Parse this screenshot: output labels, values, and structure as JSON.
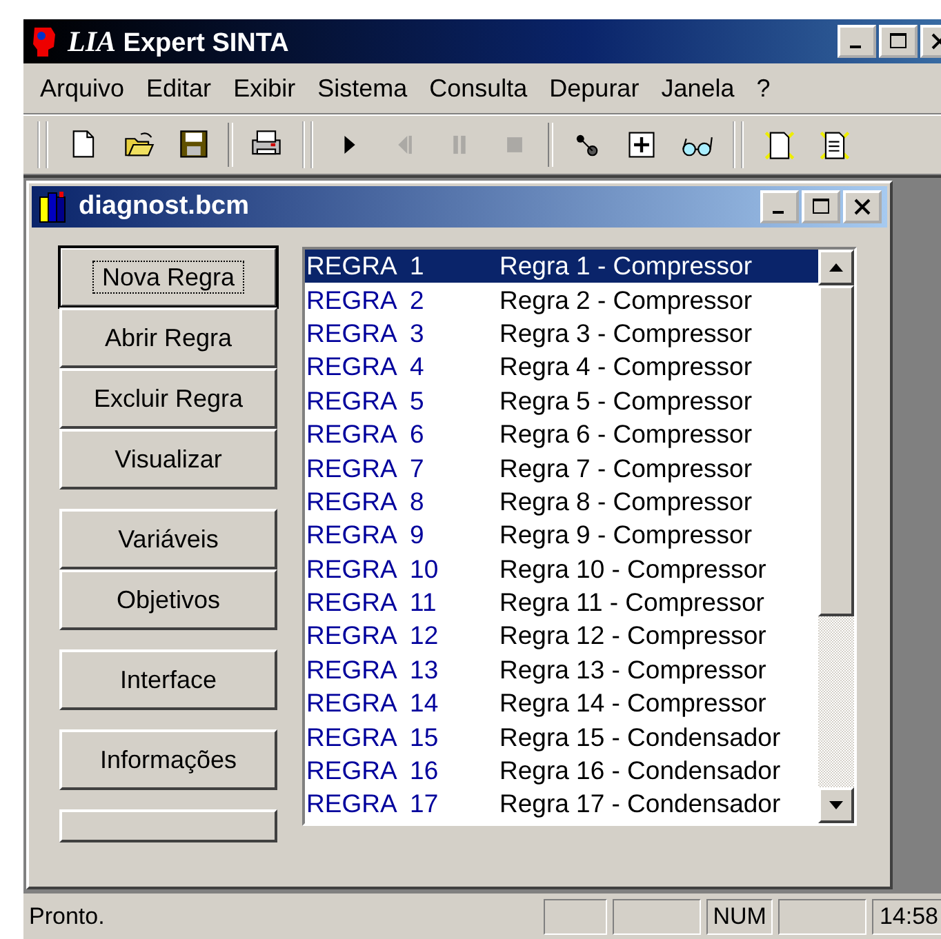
{
  "window": {
    "title_logo": "LIA",
    "title": "Expert SINTA"
  },
  "menu": [
    "Arquivo",
    "Editar",
    "Exibir",
    "Sistema",
    "Consulta",
    "Depurar",
    "Janela",
    "?"
  ],
  "toolbar": [
    {
      "kind": "new",
      "disabled": false
    },
    {
      "kind": "open",
      "disabled": false
    },
    {
      "kind": "save",
      "disabled": false
    },
    {
      "kind": "sep"
    },
    {
      "kind": "print",
      "disabled": false
    },
    {
      "kind": "grip"
    },
    {
      "kind": "play",
      "disabled": false
    },
    {
      "kind": "stepback",
      "disabled": true
    },
    {
      "kind": "pause",
      "disabled": true
    },
    {
      "kind": "stop",
      "disabled": true
    },
    {
      "kind": "sep"
    },
    {
      "kind": "link",
      "disabled": false
    },
    {
      "kind": "plus",
      "disabled": false
    },
    {
      "kind": "glasses",
      "disabled": false
    },
    {
      "kind": "grip"
    },
    {
      "kind": "sparkdoc",
      "disabled": false
    },
    {
      "kind": "sparktext",
      "disabled": false
    }
  ],
  "document": {
    "title": "diagnost.bcm",
    "buttons": [
      {
        "label": "Nova Regra",
        "focused": true
      },
      {
        "label": "Abrir Regra",
        "focused": false
      },
      {
        "label": "Excluir Regra",
        "focused": false
      },
      {
        "label": "Visualizar",
        "focused": false
      },
      {
        "label": "Variáveis",
        "focused": false
      },
      {
        "label": "Objetivos",
        "focused": false
      },
      {
        "label": "Interface",
        "focused": false
      },
      {
        "label": "Informações",
        "focused": false
      }
    ],
    "rules": [
      {
        "name": "REGRA  1",
        "title": "Regra 1 - Compressor",
        "selected": true
      },
      {
        "name": "REGRA  2",
        "title": "Regra 2 - Compressor",
        "selected": false
      },
      {
        "name": "REGRA  3",
        "title": "Regra 3 - Compressor",
        "selected": false
      },
      {
        "name": "REGRA  4",
        "title": "Regra 4 - Compressor",
        "selected": false
      },
      {
        "name": "REGRA  5",
        "title": "Regra 5 - Compressor",
        "selected": false
      },
      {
        "name": "REGRA  6",
        "title": "Regra 6 - Compressor",
        "selected": false
      },
      {
        "name": "REGRA  7",
        "title": "Regra 7 - Compressor",
        "selected": false
      },
      {
        "name": "REGRA  8",
        "title": "Regra 8 - Compressor",
        "selected": false
      },
      {
        "name": "REGRA  9",
        "title": "Regra 9 - Compressor",
        "selected": false
      },
      {
        "name": "REGRA  10",
        "title": "Regra 10 - Compressor",
        "selected": false
      },
      {
        "name": "REGRA  11",
        "title": "Regra 11 - Compressor",
        "selected": false
      },
      {
        "name": "REGRA  12",
        "title": "Regra 12 - Compressor",
        "selected": false
      },
      {
        "name": "REGRA  13",
        "title": "Regra 13 - Compressor",
        "selected": false
      },
      {
        "name": "REGRA  14",
        "title": "Regra 14 - Compressor",
        "selected": false
      },
      {
        "name": "REGRA  15",
        "title": "Regra 15 - Condensador",
        "selected": false
      },
      {
        "name": "REGRA  16",
        "title": "Regra 16 - Condensador",
        "selected": false
      },
      {
        "name": "REGRA  17",
        "title": "Regra 17 - Condensador",
        "selected": false
      }
    ]
  },
  "status_bar": {
    "message": "Pronto.",
    "indicator": "NUM",
    "clock": "14:58"
  }
}
